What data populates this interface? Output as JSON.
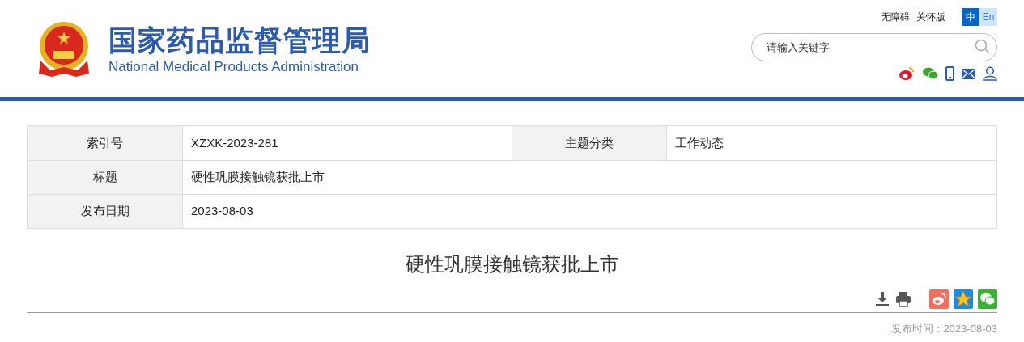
{
  "header": {
    "title": "国家药品监督管理局",
    "subtitle": "National Medical Products Administration",
    "links": [
      "无障碍",
      "关怀版"
    ],
    "languages": [
      {
        "label": "中",
        "selected": true
      },
      {
        "label": "En",
        "selected": false
      }
    ],
    "search": {
      "placeholder": "请输入关键字"
    }
  },
  "info_table": {
    "rows": [
      {
        "cells": [
          {
            "kind": "label",
            "text": "索引号"
          },
          {
            "kind": "value",
            "text": "XZXK-2023-281"
          },
          {
            "kind": "label",
            "text": "主题分类"
          },
          {
            "kind": "value",
            "text": "工作动态"
          }
        ]
      },
      {
        "cells": [
          {
            "kind": "label",
            "text": "标题"
          },
          {
            "kind": "wide",
            "text": "硬性巩膜接触镜获批上市"
          }
        ]
      },
      {
        "cells": [
          {
            "kind": "label",
            "text": "发布日期"
          },
          {
            "kind": "wide",
            "text": "2023-08-03"
          }
        ]
      }
    ]
  },
  "article": {
    "title": "硬性巩膜接触镜获批上市",
    "published": "发布时间：2023-08-03"
  }
}
